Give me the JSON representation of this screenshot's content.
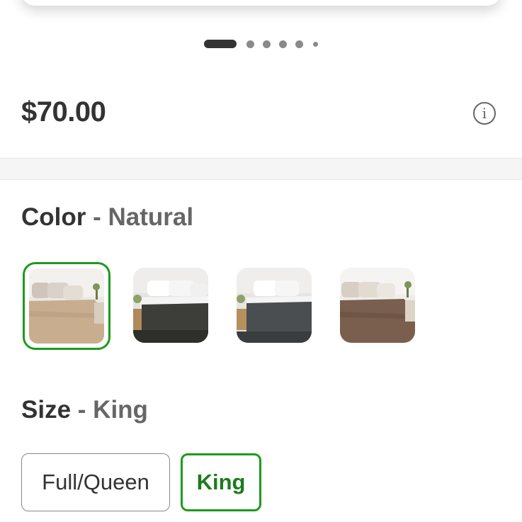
{
  "carousel": {
    "page_count": 6,
    "active_index": 0
  },
  "price": {
    "amount": "$70.00",
    "info_icon": "info-circle-icon",
    "info_glyph": "i"
  },
  "color": {
    "label": "Color",
    "separator": "-",
    "selected_value": "Natural",
    "swatches": [
      {
        "name": "bed-natural",
        "selected": true,
        "blanket_color": "#c8ad8f"
      },
      {
        "name": "bed-charcoal",
        "selected": false,
        "blanket_color": "#3d3d3a"
      },
      {
        "name": "bed-slate",
        "selected": false,
        "blanket_color": "#4a4e50"
      },
      {
        "name": "bed-brown",
        "selected": false,
        "blanket_color": "#7a5f4e"
      }
    ]
  },
  "size": {
    "label": "Size",
    "separator": "-",
    "selected_value": "King",
    "options": [
      {
        "label": "Full/Queen",
        "selected": false
      },
      {
        "label": "King",
        "selected": true
      }
    ]
  },
  "colors": {
    "accent_green": "#1e9a1e",
    "text_dark": "#333333",
    "text_muted": "#666666"
  }
}
